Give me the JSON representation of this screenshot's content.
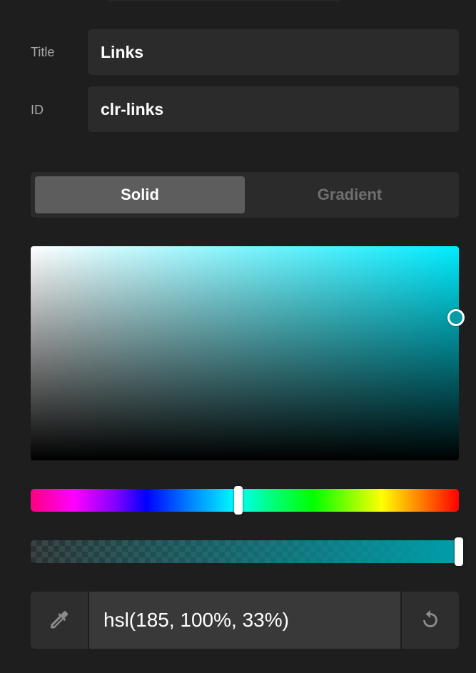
{
  "fields": {
    "title": {
      "label": "Title",
      "value": "Links"
    },
    "id": {
      "label": "ID",
      "value": "clr-links"
    }
  },
  "mode_toggle": {
    "options": [
      "Solid",
      "Gradient"
    ],
    "active": "Solid"
  },
  "color": {
    "value_text": "hsl(185, 100%, 33%)",
    "hue": 185,
    "saturation_percent": 100,
    "lightness_percent": 33,
    "alpha_percent": 100,
    "accent_hex": "#00ecff"
  },
  "icons": {
    "eyedropper": "eyedropper-icon",
    "reset": "reset-icon"
  }
}
